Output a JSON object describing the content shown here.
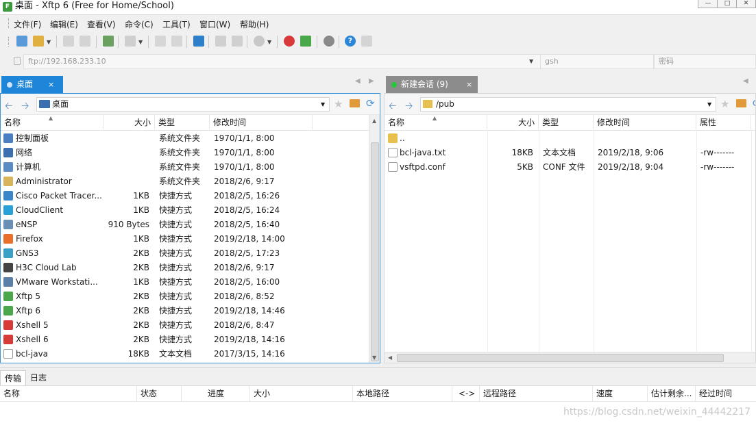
{
  "window": {
    "title": "桌面 - Xftp 6 (Free for Home/School)",
    "app_icon": "xftp-icon"
  },
  "menu": [
    "文件(F)",
    "编辑(E)",
    "查看(V)",
    "命令(C)",
    "工具(T)",
    "窗口(W)",
    "帮助(H)"
  ],
  "address": {
    "host": "ftp://192.168.233.10",
    "user": "gsh",
    "password_placeholder": "密码"
  },
  "left_tab": {
    "label": "桌面",
    "close": "×"
  },
  "right_tab": {
    "label": "新建会话 (9)",
    "close": "×"
  },
  "left_pane": {
    "path": "桌面",
    "columns": [
      "名称",
      "大小",
      "类型",
      "修改时间"
    ],
    "files": [
      {
        "name": "控制面板",
        "size": "",
        "type": "系统文件夹",
        "modified": "1970/1/1, 8:00",
        "icon": "control-panel-icon",
        "color": "#4a7fc1"
      },
      {
        "name": "网络",
        "size": "",
        "type": "系统文件夹",
        "modified": "1970/1/1, 8:00",
        "icon": "network-icon",
        "color": "#3b6fb0"
      },
      {
        "name": "计算机",
        "size": "",
        "type": "系统文件夹",
        "modified": "1970/1/1, 8:00",
        "icon": "computer-icon",
        "color": "#5a8bc5"
      },
      {
        "name": "Administrator",
        "size": "",
        "type": "系统文件夹",
        "modified": "2018/2/6, 9:17",
        "icon": "user-folder-icon",
        "color": "#d8b45a"
      },
      {
        "name": "Cisco Packet Tracer...",
        "size": "1KB",
        "type": "快捷方式",
        "modified": "2018/2/5, 16:26",
        "icon": "cisco-shortcut-icon",
        "color": "#3a86c8"
      },
      {
        "name": "CloudClient",
        "size": "1KB",
        "type": "快捷方式",
        "modified": "2018/2/5, 16:24",
        "icon": "cloudclient-shortcut-icon",
        "color": "#2aa0d8"
      },
      {
        "name": "eNSP",
        "size": "910 Bytes",
        "type": "快捷方式",
        "modified": "2018/2/5, 16:40",
        "icon": "ensp-shortcut-icon",
        "color": "#6a8fb5"
      },
      {
        "name": "Firefox",
        "size": "1KB",
        "type": "快捷方式",
        "modified": "2019/2/18, 14:00",
        "icon": "firefox-shortcut-icon",
        "color": "#e8702a"
      },
      {
        "name": "GNS3",
        "size": "2KB",
        "type": "快捷方式",
        "modified": "2018/2/5, 17:23",
        "icon": "gns3-shortcut-icon",
        "color": "#3aa0c8"
      },
      {
        "name": "H3C Cloud Lab",
        "size": "2KB",
        "type": "快捷方式",
        "modified": "2018/2/6, 9:17",
        "icon": "h3c-shortcut-icon",
        "color": "#444444"
      },
      {
        "name": "VMware Workstati...",
        "size": "1KB",
        "type": "快捷方式",
        "modified": "2018/2/5, 16:00",
        "icon": "vmware-shortcut-icon",
        "color": "#5c7fa8"
      },
      {
        "name": "Xftp 5",
        "size": "2KB",
        "type": "快捷方式",
        "modified": "2018/2/6, 8:52",
        "icon": "xftp5-shortcut-icon",
        "color": "#4aa84a"
      },
      {
        "name": "Xftp 6",
        "size": "2KB",
        "type": "快捷方式",
        "modified": "2019/2/18, 14:46",
        "icon": "xftp6-shortcut-icon",
        "color": "#4aa84a"
      },
      {
        "name": "Xshell 5",
        "size": "2KB",
        "type": "快捷方式",
        "modified": "2018/2/6, 8:47",
        "icon": "xshell5-shortcut-icon",
        "color": "#d83a3a"
      },
      {
        "name": "Xshell 6",
        "size": "2KB",
        "type": "快捷方式",
        "modified": "2019/2/18, 14:16",
        "icon": "xshell6-shortcut-icon",
        "color": "#d83a3a"
      },
      {
        "name": "bcl-java",
        "size": "18KB",
        "type": "文本文档",
        "modified": "2017/3/15, 14:16",
        "icon": "text-file-icon",
        "color": "#ffffff"
      }
    ]
  },
  "right_pane": {
    "path": "/pub",
    "columns": [
      "名称",
      "大小",
      "类型",
      "修改时间",
      "属性"
    ],
    "files": [
      {
        "name": "..",
        "size": "",
        "type": "",
        "modified": "",
        "attr": "",
        "icon": "parent-folder-icon",
        "color": "#e8c050"
      },
      {
        "name": "bcl-java.txt",
        "size": "18KB",
        "type": "文本文档",
        "modified": "2019/2/18, 9:06",
        "attr": "-rw-------",
        "icon": "text-file-icon",
        "color": "#ffffff"
      },
      {
        "name": "vsftpd.conf",
        "size": "5KB",
        "type": "CONF 文件",
        "modified": "2019/2/18, 9:04",
        "attr": "-rw-------",
        "icon": "text-file-icon",
        "color": "#ffffff"
      }
    ]
  },
  "bottom_tabs": [
    "传输",
    "日志"
  ],
  "transfer_columns": [
    "名称",
    "状态",
    "进度",
    "大小",
    "本地路径",
    "<->",
    "远程路径",
    "速度",
    "估计剩余...",
    "经过时间"
  ],
  "watermark": "https://blog.csdn.net/weixin_44442217",
  "colors": {
    "tab_active": "#1e86d8",
    "tab_inactive": "#8c8c8c",
    "connected_dot": "#25c83c"
  }
}
